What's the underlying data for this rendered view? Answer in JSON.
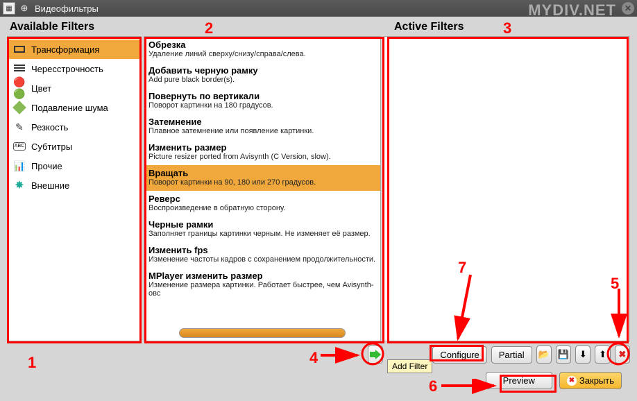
{
  "window": {
    "title": "Видеофильтры",
    "watermark": "MYDIV.NET"
  },
  "headers": {
    "available": "Available Filters",
    "active": "Active Filters"
  },
  "categories": [
    {
      "label": "Трансформация",
      "icon": "transform",
      "selected": true
    },
    {
      "label": "Чересстрочность",
      "icon": "interlace",
      "selected": false
    },
    {
      "label": "Цвет",
      "icon": "color",
      "selected": false
    },
    {
      "label": "Подавление шума",
      "icon": "noise",
      "selected": false
    },
    {
      "label": "Резкость",
      "icon": "sharp",
      "selected": false
    },
    {
      "label": "Субтитры",
      "icon": "sub",
      "selected": false
    },
    {
      "label": "Прочие",
      "icon": "misc",
      "selected": false
    },
    {
      "label": "Внешние",
      "icon": "ext",
      "selected": false
    }
  ],
  "filters": [
    {
      "title": "Обрезка",
      "desc": "Удаление линий сверху/снизу/справа/слева.",
      "selected": false
    },
    {
      "title": "Добавить черную рамку",
      "desc": "Add pure black border(s).",
      "selected": false
    },
    {
      "title": "Повернуть по вертикали",
      "desc": "Поворот картинки на 180 градусов.",
      "selected": false
    },
    {
      "title": "Затемнение",
      "desc": "Плавное затемнение или появление картинки.",
      "selected": false
    },
    {
      "title": "Изменить размер",
      "desc": "Picture resizer ported from Avisynth (C Version, slow).",
      "selected": false
    },
    {
      "title": "Вращать",
      "desc": "Поворот картинки на 90, 180 или 270 градусов.",
      "selected": true
    },
    {
      "title": "Реверс",
      "desc": "Воспроизведение в обратную сторону.",
      "selected": false
    },
    {
      "title": "Черные рамки",
      "desc": "Заполняет границы картинки черным. Не изменяет её размер.",
      "selected": false
    },
    {
      "title": "Изменить fps",
      "desc": "Изменение частоты кадров с сохранением продолжительности.",
      "selected": false
    },
    {
      "title": "MPlayer изменить размер",
      "desc": "Изменение размера картинки. Работает быстрее, чем Avisynth-овс",
      "selected": false
    }
  ],
  "toolbar": {
    "add_tooltip": "Add Filter",
    "configure": "Configure",
    "partial": "Partial"
  },
  "bottom": {
    "preview": "Preview",
    "close": "Закрыть"
  },
  "annotations": {
    "n1": "1",
    "n2": "2",
    "n3": "3",
    "n4": "4",
    "n5": "5",
    "n6": "6",
    "n7": "7"
  }
}
